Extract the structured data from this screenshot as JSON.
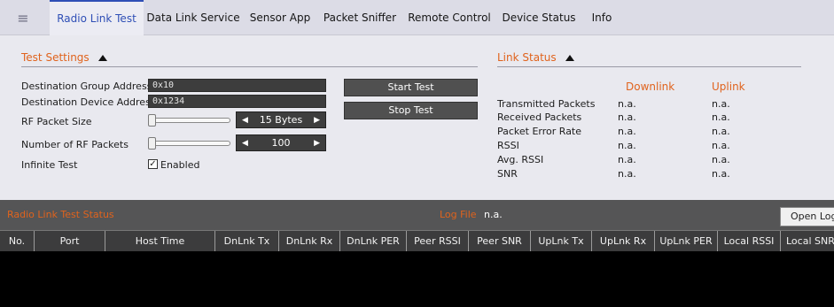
{
  "nav": {
    "menu_icon": "hamburger-icon",
    "tabs": [
      {
        "label": "Radio Link Test",
        "active": true
      },
      {
        "label": "Data Link Service"
      },
      {
        "label": "Sensor App"
      },
      {
        "label": "Packet Sniffer"
      },
      {
        "label": "Remote Control"
      },
      {
        "label": "Device Status"
      },
      {
        "label": "Info"
      }
    ]
  },
  "test_settings": {
    "title": "Test Settings",
    "dest_group_label": "Destination Group Address",
    "dest_group_value": "0x10",
    "dest_device_label": "Destination Device Address",
    "dest_device_value": "0x1234",
    "rf_size_label": "RF Packet Size",
    "rf_size_value": "15 Bytes",
    "rf_count_label": "Number of RF Packets",
    "rf_count_value": "100",
    "infinite_label": "Infinite Test",
    "infinite_checked": true,
    "infinite_text": "Enabled",
    "start_label": "Start Test",
    "stop_label": "Stop Test"
  },
  "link_status": {
    "title": "Link Status",
    "downlink_label": "Downlink",
    "uplink_label": "Uplink",
    "rows": [
      {
        "label": "Transmitted Packets",
        "down": "n.a.",
        "up": "n.a."
      },
      {
        "label": "Received Packets",
        "down": "n.a.",
        "up": "n.a."
      },
      {
        "label": "Packet Error Rate",
        "down": "n.a.",
        "up": "n.a."
      },
      {
        "label": "RSSI",
        "down": "n.a.",
        "up": "n.a."
      },
      {
        "label": "Avg. RSSI",
        "down": "n.a.",
        "up": "n.a."
      },
      {
        "label": "SNR",
        "down": "n.a.",
        "up": "n.a."
      }
    ]
  },
  "status": {
    "title": "Radio Link Test Status",
    "log_file_label": "Log File",
    "log_file_value": "n.a.",
    "open_log_label": "Open Log",
    "columns": [
      "No.",
      "Port",
      "Host Time",
      "DnLnk Tx",
      "DnLnk Rx",
      "DnLnk PER",
      "Peer RSSI",
      "Peer SNR",
      "UpLnk Tx",
      "UpLnk Rx",
      "UpLnk PER",
      "Local RSSI",
      "Local SNR"
    ]
  },
  "colors": {
    "accent_orange": "#e0631d",
    "active_tab_blue": "#2f4fb6"
  }
}
